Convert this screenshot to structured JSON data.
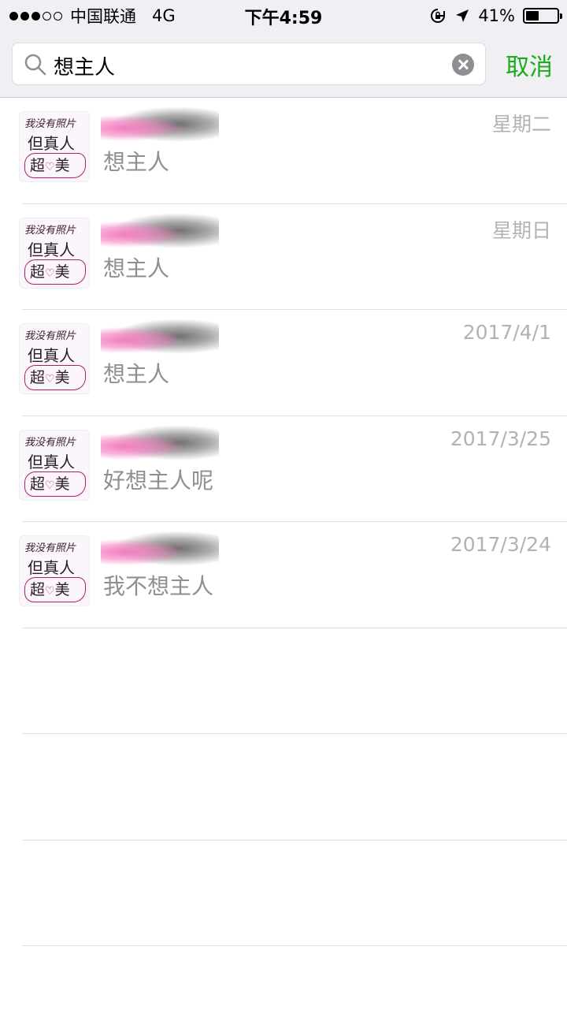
{
  "status_bar": {
    "carrier": "中国联通",
    "network": "4G",
    "time": "下午4:59",
    "battery_percent": "41%",
    "battery_level": 0.41
  },
  "search": {
    "query": "想主人",
    "cancel_label": "取消"
  },
  "avatar_text": {
    "line1": "我没有照片",
    "line2": "但真人",
    "line3": "超",
    "line3_end": "美"
  },
  "results": [
    {
      "snippet": "想主人",
      "date": "星期二"
    },
    {
      "snippet": "想主人",
      "date": "星期日"
    },
    {
      "snippet": "想主人",
      "date": "2017/4/1"
    },
    {
      "snippet": "好想主人呢",
      "date": "2017/3/25"
    },
    {
      "snippet": "我不想主人",
      "date": "2017/3/24"
    }
  ],
  "colors": {
    "accent": "#1aad19",
    "snippet_text": "#8e8e93",
    "date_text": "#b2b2b2",
    "header_bg": "#efeff4"
  }
}
